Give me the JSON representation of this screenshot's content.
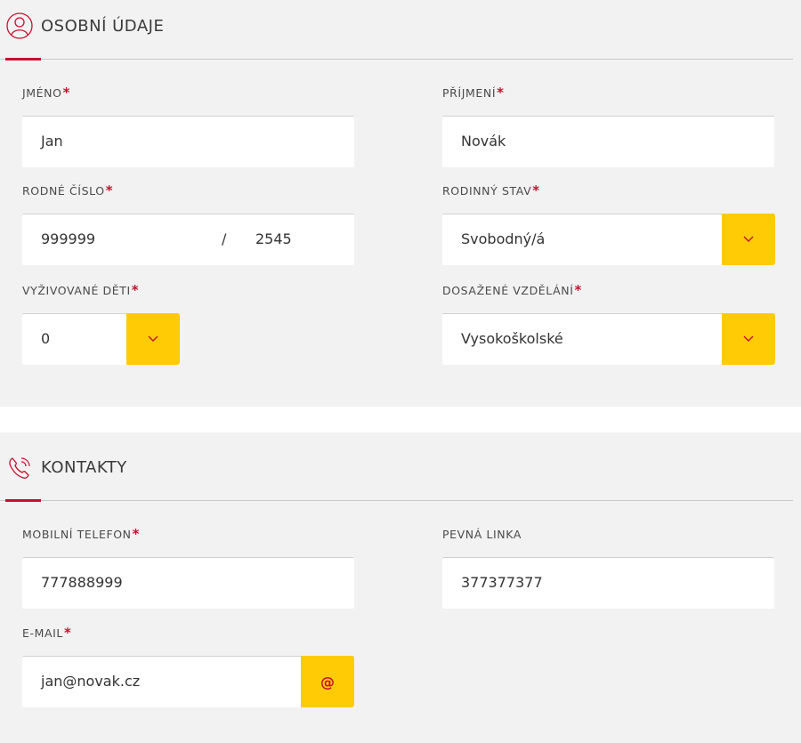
{
  "personal": {
    "title": "OSOBNÍ ÚDAJE",
    "icon": "person-icon",
    "first_name": {
      "label": "JMÉNO",
      "required": "*",
      "value": "Jan"
    },
    "last_name": {
      "label": "PŘÍJMENÍ",
      "required": "*",
      "value": "Novák"
    },
    "birth_number": {
      "label": "RODNÉ ČÍSLO",
      "required": "*",
      "value": "999999",
      "separator": "/",
      "suffix": "2545"
    },
    "marital_status": {
      "label": "RODINNÝ STAV",
      "required": "*",
      "value": "Svobodný/á"
    },
    "dependent_children": {
      "label": "VYŽIVOVANÉ DĚTI",
      "required": "*",
      "value": "0"
    },
    "education": {
      "label": "DOSAŽENÉ VZDĚLÁNÍ",
      "required": "*",
      "value": "Vysokoškolské"
    }
  },
  "contacts": {
    "title": "KONTAKTY",
    "icon": "phone-icon",
    "mobile": {
      "label": "MOBILNÍ TELEFON",
      "required": "*",
      "value": "777888999"
    },
    "landline": {
      "label": "PEVNÁ LINKA",
      "value": "377377377"
    },
    "email": {
      "label": "E-MAIL",
      "required": "*",
      "value": "jan@novak.cz",
      "button_glyph": "@"
    }
  },
  "colors": {
    "accent": "#c8102e",
    "button": "#ffcb05",
    "panel": "#f2f2f2"
  }
}
